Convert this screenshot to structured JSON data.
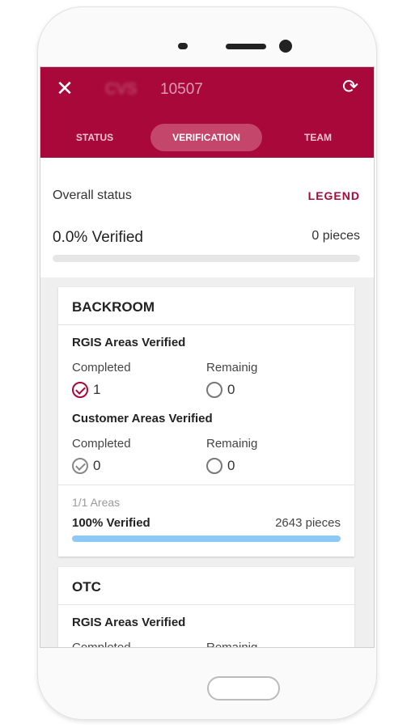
{
  "header": {
    "title_code": "CVS",
    "title_number": "10507",
    "tabs": [
      {
        "label": "STATUS",
        "active": false
      },
      {
        "label": "VERIFICATION",
        "active": true
      },
      {
        "label": "TEAM",
        "active": false
      }
    ],
    "icons": {
      "close": "close-icon",
      "refresh": "refresh-icon"
    }
  },
  "overall": {
    "label": "Overall status",
    "legend_link": "LEGEND",
    "verified_text": "0.0% Verified",
    "pieces_text": "0 pieces",
    "progress": 0
  },
  "cards": [
    {
      "title": "BACKROOM",
      "groups": [
        {
          "heading": "RGIS Areas Verified",
          "completed_label": "Completed",
          "remaining_label": "Remainig",
          "completed": "1",
          "remaining": "0",
          "completed_icon": "check-circle-red-icon",
          "remaining_icon": "pending-circle-icon"
        },
        {
          "heading": "Customer Areas Verified",
          "completed_label": "Completed",
          "remaining_label": "Remainig",
          "completed": "0",
          "remaining": "0",
          "completed_icon": "check-circle-grey-icon",
          "remaining_icon": "pending-circle-icon"
        }
      ],
      "areas_text": "1/1 Areas",
      "verified_text": "100% Verified",
      "pieces_text": "2643 pieces",
      "progress": 1.0
    },
    {
      "title": "OTC",
      "groups": [
        {
          "heading": "RGIS Areas Verified",
          "completed_label": "Completed",
          "remaining_label": "Remainig"
        }
      ]
    }
  ],
  "colors": {
    "brand": "#a8093a",
    "progress_fill": "#8ec8f4",
    "active_tab": "#c4466b"
  }
}
